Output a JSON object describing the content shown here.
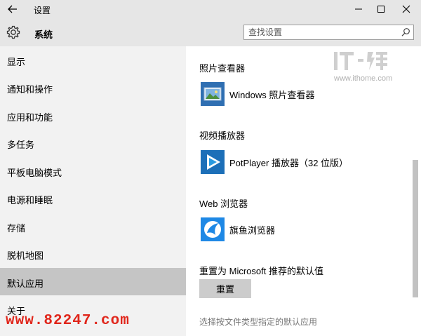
{
  "window": {
    "title": "设置"
  },
  "header": {
    "title": "系统",
    "search_placeholder": "查找设置"
  },
  "sidebar": {
    "items": [
      {
        "label": "显示"
      },
      {
        "label": "通知和操作"
      },
      {
        "label": "应用和功能"
      },
      {
        "label": "多任务"
      },
      {
        "label": "平板电脑模式"
      },
      {
        "label": "电源和睡眠"
      },
      {
        "label": "存储"
      },
      {
        "label": "脱机地图"
      },
      {
        "label": "默认应用",
        "selected": true
      },
      {
        "label": "关于"
      }
    ]
  },
  "main": {
    "photo": {
      "heading": "照片查看器",
      "app": "Windows 照片查看器",
      "icon": "photo-viewer-icon"
    },
    "video": {
      "heading": "视频播放器",
      "app": "PotPlayer 播放器（32 位版）",
      "icon": "potplayer-icon"
    },
    "browser": {
      "heading": "Web 浏览器",
      "app": "旗鱼浏览器",
      "icon": "qiyu-browser-icon"
    },
    "reset": {
      "heading": "重置为 Microsoft 推荐的默认值",
      "button": "重置"
    },
    "link": "选择按文件类型指定的默认应用"
  },
  "watermarks": {
    "ithome_url": "www.ithome.com",
    "site": "www.82247.com"
  },
  "colors": {
    "titlebar": "#e6e6e6",
    "sidebar": "#f2f2f2",
    "selected": "#c5c5c5",
    "accent_blue": "#1e88e5",
    "watermark_red": "#e0261b"
  }
}
